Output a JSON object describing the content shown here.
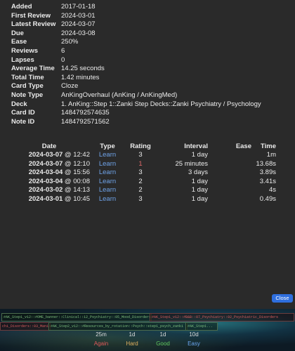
{
  "info": [
    {
      "label": "Added",
      "value": "2017-01-18"
    },
    {
      "label": "First Review",
      "value": "2024-03-01"
    },
    {
      "label": "Latest Review",
      "value": "2024-03-07"
    },
    {
      "label": "Due",
      "value": "2024-03-08"
    },
    {
      "label": "Ease",
      "value": "250%"
    },
    {
      "label": "Reviews",
      "value": "6"
    },
    {
      "label": "Lapses",
      "value": "0"
    },
    {
      "label": "Average Time",
      "value": "14.25 seconds"
    },
    {
      "label": "Total Time",
      "value": "1.42 minutes"
    },
    {
      "label": "Card Type",
      "value": "Cloze"
    },
    {
      "label": "Note Type",
      "value": "AnKingOverhaul (AnKing / AnKingMed)"
    },
    {
      "label": "Deck",
      "value": "1. AnKing::Step 1::Zanki Step Decks::Zanki Psychiatry / Psychology"
    },
    {
      "label": "Card ID",
      "value": "1484792574635"
    },
    {
      "label": "Note ID",
      "value": "1484792571562"
    }
  ],
  "reviews": {
    "headers": {
      "date": "Date",
      "type": "Type",
      "rating": "Rating",
      "interval": "Interval",
      "ease": "Ease",
      "time": "Time"
    },
    "rows": [
      {
        "date": "2024-03-07",
        "at": " @ 12:42",
        "type": "Learn",
        "rating": "3",
        "interval": "1 day",
        "ease": "",
        "time": "1m"
      },
      {
        "date": "2024-03-07",
        "at": " @ 12:10",
        "type": "Learn",
        "rating": "1",
        "interval": "25 minutes",
        "ease": "",
        "time": "13.68s"
      },
      {
        "date": "2024-03-04",
        "at": " @ 15:56",
        "type": "Learn",
        "rating": "3",
        "interval": "3 days",
        "ease": "",
        "time": "3.89s"
      },
      {
        "date": "2024-03-04",
        "at": " @ 00:08",
        "type": "Learn",
        "rating": "2",
        "interval": "1 day",
        "ease": "",
        "time": "3.41s"
      },
      {
        "date": "2024-03-02",
        "at": " @ 14:13",
        "type": "Learn",
        "rating": "2",
        "interval": "1 day",
        "ease": "",
        "time": "4s"
      },
      {
        "date": "2024-03-01",
        "at": " @ 10:45",
        "type": "Learn",
        "rating": "3",
        "interval": "1 day",
        "ease": "",
        "time": "0.49s"
      }
    ]
  },
  "close_label": "Close",
  "tags": {
    "t1": "#AK_Step1_v12::#OME_banner::Clinical::12_Psychiatry::05_Mood_Disorders",
    "t2": "#AK_Step1_v12::#B&B::07_Psychiatry::02_Psychiatric_Disorders",
    "t3": "chi_Disorders::03_Mania",
    "t4": "#AK_Step2_v12::#Resources_by_rotation::Psych::step1_psych_zanki",
    "t5": "#AK_Step1..."
  },
  "answer_bar": {
    "again": {
      "interval": "25m",
      "label": "Again",
      "color": "#e05a5a"
    },
    "hard": {
      "interval": "1d",
      "label": "Hard",
      "color": "#e0b060"
    },
    "good": {
      "interval": "1d",
      "label": "Good",
      "color": "#5fc95f"
    },
    "easy": {
      "interval": "10d",
      "label": "Easy",
      "color": "#6ba6f0"
    }
  }
}
